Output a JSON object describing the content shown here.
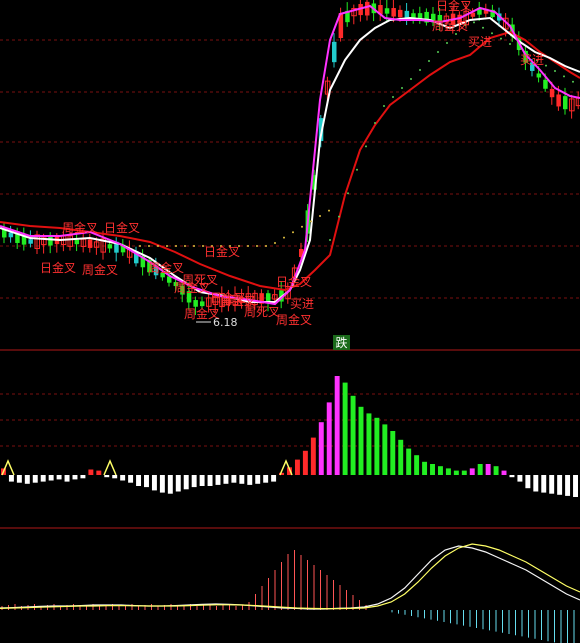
{
  "colors": {
    "background": "#000000",
    "grid": "#7a1010",
    "separator": "#b01818",
    "up": "#ff2a2a",
    "down": "#22ee22",
    "hollow": "#22cccc",
    "ma_white": "#ffffff",
    "ma_magenta": "#ff33ff",
    "ma_red": "#e01010",
    "dots": "#55cc55",
    "signal_text": "#ff3030",
    "low_marker": "#dddddd",
    "macd_magenta": "#ff33ff",
    "macd_neg": "#ffffff",
    "osc_line_a": "#ffff66",
    "osc_line_b": "#f5f5f5",
    "osc_neg": "#66ddee",
    "osc_pos": "#ff5555",
    "badge_bg": "#1a6a1a",
    "badge_text": "#ffffff"
  },
  "top_panel": {
    "low_marker": "6.18",
    "signals": [
      "周金叉",
      "日金叉",
      "周金叉",
      "日金叉",
      "周金叉",
      "日金叉",
      "日金叉",
      "周金叉",
      "周死叉",
      "日金叉",
      "周金叉",
      "周金叉",
      "日金叉",
      "买进",
      "周死叉",
      "买进",
      "周金叉",
      "日金叉",
      "买进"
    ]
  },
  "badge": {
    "label": "跌"
  },
  "chart_data": [
    {
      "type": "candlestick",
      "title": "",
      "price_low_label": 6.18,
      "overlays": [
        "white MA",
        "magenta MA",
        "red MA",
        "green dotted line"
      ]
    },
    {
      "type": "bar",
      "title": "",
      "series": [
        {
          "values": [
            0.3,
            -0.3,
            -0.35,
            -0.4,
            -0.35,
            -0.3,
            -0.25,
            -0.2,
            -0.3,
            -0.2,
            -0.15,
            0.25,
            0.2,
            -0.1,
            -0.15,
            -0.25,
            -0.35,
            -0.5,
            -0.55,
            -0.7,
            -0.8,
            -0.85,
            -0.75,
            -0.65,
            -0.55,
            -0.5,
            -0.5,
            -0.45,
            -0.4,
            -0.35,
            -0.4,
            -0.45,
            -0.4,
            -0.35,
            -0.3,
            0.1,
            0.35,
            0.7,
            1.1,
            1.7,
            2.4,
            3.3,
            4.5,
            4.2,
            3.6,
            3.1,
            2.8,
            2.6,
            2.3,
            2.0,
            1.6,
            1.2,
            0.9,
            0.6,
            0.5,
            0.4,
            0.3,
            0.2,
            0.2,
            0.3,
            0.5,
            0.5,
            0.4,
            0.2,
            -0.1,
            -0.3,
            -0.6,
            -0.75,
            -0.8,
            -0.85,
            -0.9,
            -0.95,
            -1.0
          ]
        }
      ]
    },
    {
      "type": "line",
      "title": "",
      "series": [
        {
          "name": "",
          "values": [
            0.1,
            0.12,
            0.15,
            0.18,
            0.2,
            0.2,
            0.22,
            0.25,
            0.25,
            0.25,
            0.22,
            0.2,
            0.2,
            0.22,
            0.25,
            0.28,
            0.3,
            0.28,
            0.25,
            0.2,
            0.15,
            0.1,
            0.08,
            0.05,
            0.05,
            0.08,
            0.1,
            0.15,
            0.3,
            0.6,
            1.1,
            1.8,
            2.5,
            3.0,
            3.2,
            3.1,
            2.9,
            2.6,
            2.3,
            2.0,
            1.6,
            1.2,
            0.8,
            0.5
          ]
        },
        {
          "name": "",
          "values": [
            0.08,
            0.1,
            0.12,
            0.14,
            0.16,
            0.18,
            0.2,
            0.2,
            0.22,
            0.22,
            0.21,
            0.2,
            0.2,
            0.2,
            0.22,
            0.24,
            0.26,
            0.26,
            0.25,
            0.22,
            0.18,
            0.14,
            0.1,
            0.08,
            0.07,
            0.07,
            0.08,
            0.1,
            0.2,
            0.4,
            0.8,
            1.4,
            2.1,
            2.7,
            3.1,
            3.3,
            3.2,
            3.0,
            2.7,
            2.4,
            2.0,
            1.6,
            1.2,
            0.9
          ]
        }
      ]
    }
  ]
}
